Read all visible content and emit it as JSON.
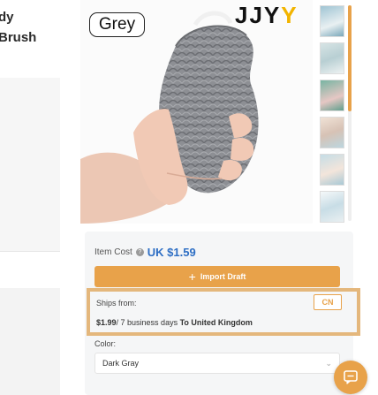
{
  "left_title": {
    "line1": "dy",
    "line2": "Brush"
  },
  "product_image": {
    "label": "Grey",
    "brand_prefix": "JJY",
    "brand_accent": "Y"
  },
  "thumbnails": [
    {
      "name": "thumb-1",
      "color": "#8fb8c9"
    },
    {
      "name": "thumb-2",
      "color": "#c9d7d8"
    },
    {
      "name": "thumb-3",
      "color": "#7fb7a6"
    },
    {
      "name": "thumb-4",
      "color": "#e8d9cc"
    },
    {
      "name": "thumb-5",
      "color": "#b8d5e0"
    },
    {
      "name": "thumb-6",
      "color": "#eef3f5"
    }
  ],
  "item_cost": {
    "label": "Item Cost",
    "price": "UK $1.59"
  },
  "import_button": {
    "label": "Import Draft"
  },
  "shipping": {
    "from_label": "Ships from:",
    "origin": "CN",
    "price": "$1.99",
    "days": "/ 7 business days",
    "destination": "To United Kingdom"
  },
  "color": {
    "label": "Color:",
    "selected": "Dark Gray"
  },
  "colors": {
    "accent": "#e8a24a",
    "price_blue": "#2d6ec4",
    "highlight_border": "#e4b77c"
  }
}
